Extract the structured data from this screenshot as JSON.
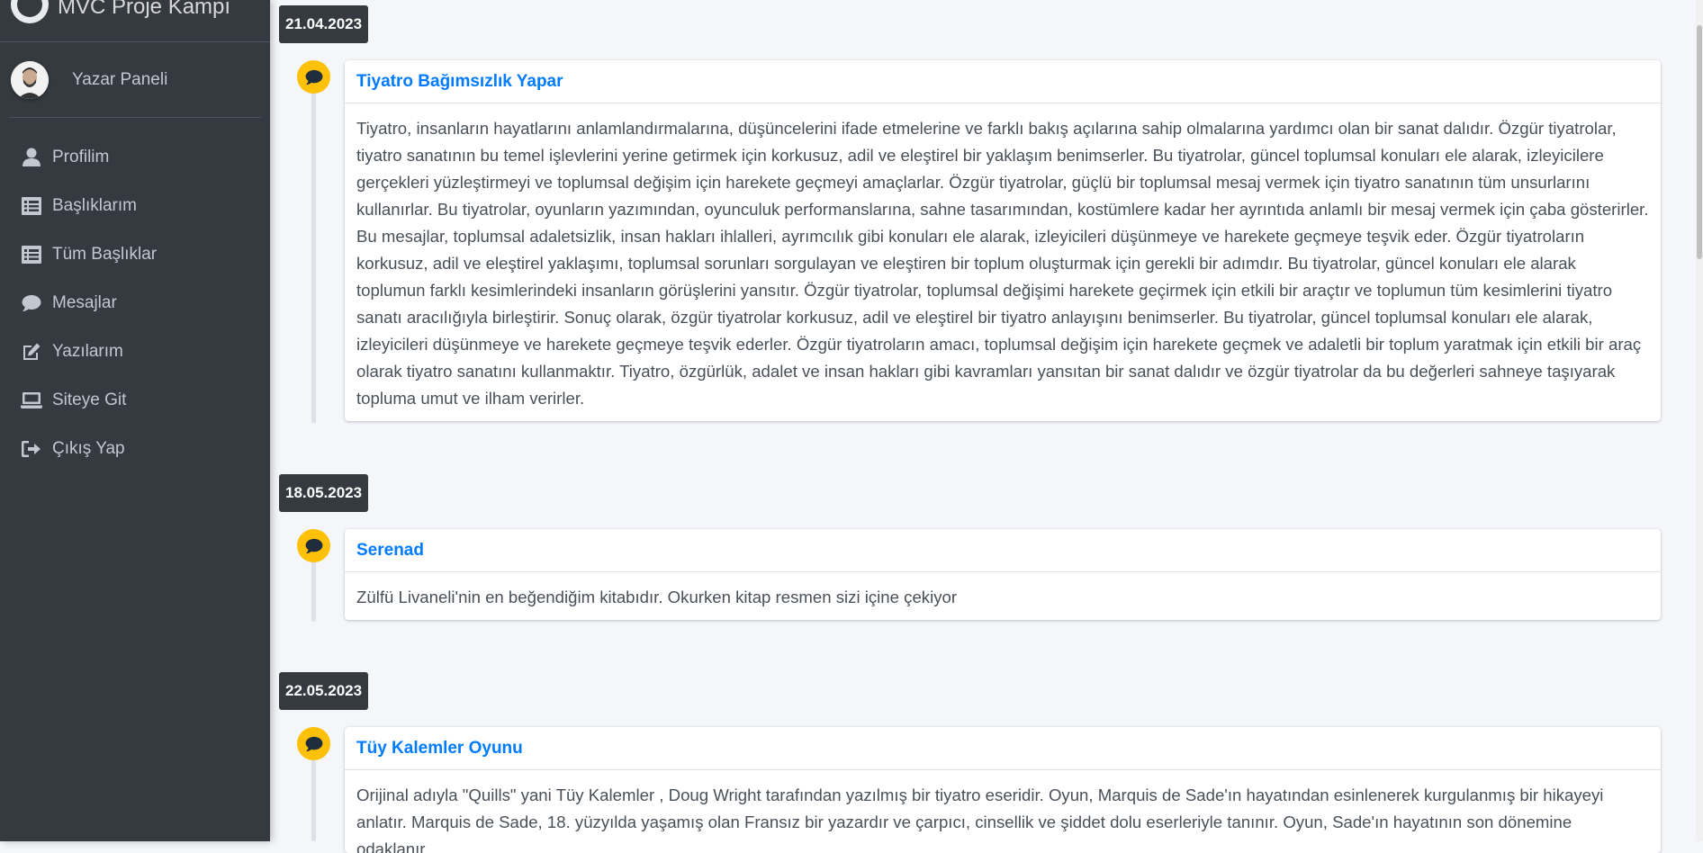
{
  "sidebar": {
    "brand": "MVC Proje Kampı",
    "user_name": "Yazar Paneli",
    "items": [
      {
        "label": "Profilim",
        "icon": "user-icon"
      },
      {
        "label": "Başlıklarım",
        "icon": "list-icon"
      },
      {
        "label": "Tüm Başlıklar",
        "icon": "list-icon"
      },
      {
        "label": "Mesajlar",
        "icon": "comment-icon"
      },
      {
        "label": "Yazılarım",
        "icon": "edit-icon"
      },
      {
        "label": "Siteye Git",
        "icon": "laptop-icon"
      },
      {
        "label": "Çıkış Yap",
        "icon": "sign-out-icon"
      }
    ]
  },
  "timeline": [
    {
      "date": "21.04.2023",
      "title": "Tiyatro Bağımsızlık Yapar",
      "body": "Tiyatro, insanların hayatlarını anlamlandırmalarına, düşüncelerini ifade etmelerine ve farklı bakış açılarına sahip olmalarına yardımcı olan bir sanat dalıdır. Özgür tiyatrolar, tiyatro sanatının bu temel işlevlerini yerine getirmek için korkusuz, adil ve eleştirel bir yaklaşım benimserler. Bu tiyatrolar, güncel toplumsal konuları ele alarak, izleyicilere gerçekleri yüzleştirmeyi ve toplumsal değişim için harekete geçmeyi amaçlarlar. Özgür tiyatrolar, güçlü bir toplumsal mesaj vermek için tiyatro sanatının tüm unsurlarını kullanırlar. Bu tiyatrolar, oyunların yazımından, oyunculuk performanslarına, sahne tasarımından, kostümlere kadar her ayrıntıda anlamlı bir mesaj vermek için çaba gösterirler. Bu mesajlar, toplumsal adaletsizlik, insan hakları ihlalleri, ayrımcılık gibi konuları ele alarak, izleyicileri düşünmeye ve harekete geçmeye teşvik eder. Özgür tiyatroların korkusuz, adil ve eleştirel yaklaşımı, toplumsal sorunları sorgulayan ve eleştiren bir toplum oluşturmak için gerekli bir adımdır. Bu tiyatrolar, güncel konuları ele alarak toplumun farklı kesimlerindeki insanların görüşlerini yansıtır. Özgür tiyatrolar, toplumsal değişimi harekete geçirmek için etkili bir araçtır ve toplumun tüm kesimlerini tiyatro sanatı aracılığıyla birleştirir. Sonuç olarak, özgür tiyatrolar korkusuz, adil ve eleştirel bir tiyatro anlayışını benimserler. Bu tiyatrolar, güncel toplumsal konuları ele alarak, izleyicileri düşünmeye ve harekete geçmeye teşvik ederler. Özgür tiyatroların amacı, toplumsal değişim için harekete geçmek ve adaletli bir toplum yaratmak için etkili bir araç olarak tiyatro sanatını kullanmaktır. Tiyatro, özgürlük, adalet ve insan hakları gibi kavramları yansıtan bir sanat dalıdır ve özgür tiyatrolar da bu değerleri sahneye taşıyarak topluma umut ve ilham verirler."
    },
    {
      "date": "18.05.2023",
      "title": "Serenad",
      "body": "Zülfü Livaneli'nin en beğendiğim kitabıdır. Okurken kitap resmen sizi içine çekiyor"
    },
    {
      "date": "22.05.2023",
      "title": "Tüy Kalemler Oyunu",
      "body": "Orijinal adıyla \"Quills\" yani Tüy Kalemler , Doug Wright tarafından yazılmış bir tiyatro eseridir. Oyun, Marquis de Sade'ın hayatından esinlenerek kurgulanmış bir hikayeyi anlatır. Marquis de Sade, 18. yüzyılda yaşamış olan Fransız bir yazardır ve çarpıcı, cinsellik ve şiddet dolu eserleriyle tanınır. Oyun, Sade'ın hayatının son dönemine odaklanır."
    }
  ],
  "colors": {
    "sidebar_bg": "#343a40",
    "content_bg": "#f4f6f9",
    "timeline_icon": "#ffc107",
    "title_link": "#007bff"
  }
}
